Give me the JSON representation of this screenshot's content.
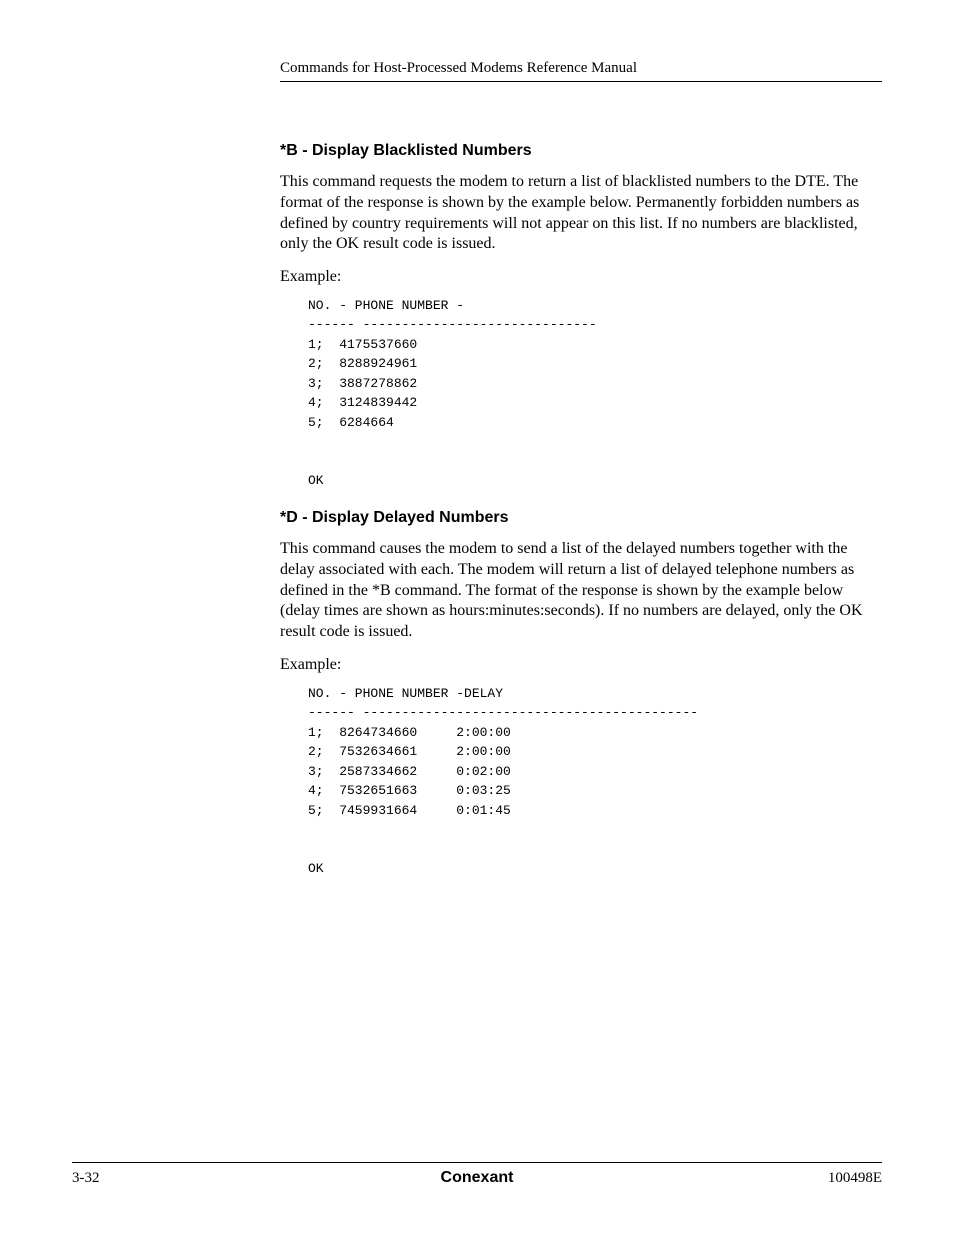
{
  "header": {
    "title": "Commands for Host-Processed Modems Reference Manual"
  },
  "section1": {
    "heading": "*B - Display Blacklisted Numbers",
    "paragraph": "This command requests the modem to return a list of blacklisted numbers to the DTE. The format of the response is shown by the example below. Permanently forbidden numbers as defined by country requirements will not appear on this list. If no numbers are blacklisted, only the OK result code is issued.",
    "example_label": "Example:",
    "code": "NO. - PHONE NUMBER -\n------ ------------------------------\n1;  4175537660\n2;  8288924961\n3;  3887278862\n4;  3124839442\n5;  6284664\n\n\nOK"
  },
  "section2": {
    "heading": "*D - Display Delayed Numbers",
    "paragraph": "This command causes the modem to send a list of the delayed numbers together with the delay associated with each. The modem will return a list of delayed telephone numbers as defined in the *B command. The format of the response is shown by the example below (delay times are shown as hours:minutes:seconds). If no numbers are delayed, only the OK result code is issued.",
    "example_label": "Example:",
    "code": "NO. - PHONE NUMBER -DELAY\n------ -------------------------------------------\n1;  8264734660     2:00:00\n2;  7532634661     2:00:00\n3;  2587334662     0:02:00\n4;  7532651663     0:03:25\n5;  7459931664     0:01:45\n\n\nOK"
  },
  "footer": {
    "left": "3-32",
    "center": "Conexant",
    "right": "100498E"
  }
}
